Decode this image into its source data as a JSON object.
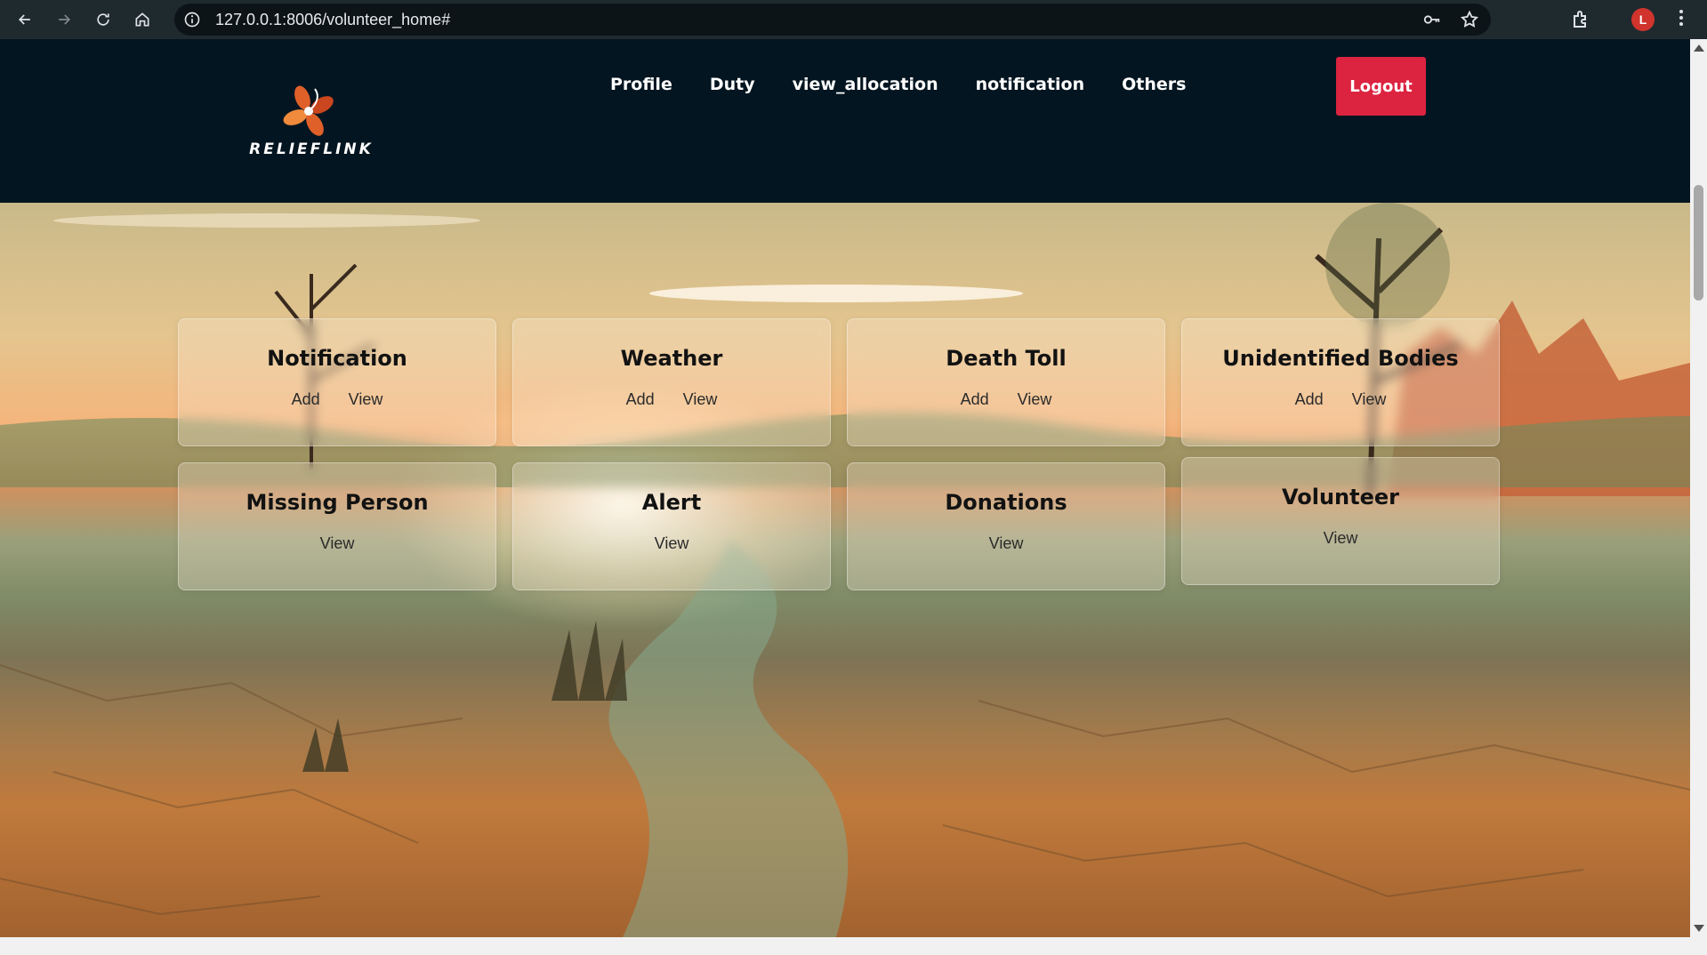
{
  "browser": {
    "url": "127.0.0.1:8006/volunteer_home#",
    "profile_initial": "L"
  },
  "header": {
    "logo_text": "RELIEFLINK",
    "nav": [
      "Profile",
      "Duty",
      "view_allocation",
      "notification",
      "Others"
    ],
    "logout_label": "Logout"
  },
  "cards": [
    {
      "title": "Notification",
      "links": [
        "Add",
        "View"
      ]
    },
    {
      "title": "Weather",
      "links": [
        "Add",
        "View"
      ]
    },
    {
      "title": "Death Toll",
      "links": [
        "Add",
        "View"
      ]
    },
    {
      "title": "Unidentified Bodies",
      "links": [
        "Add",
        "View"
      ]
    },
    {
      "title": "Missing Person",
      "links": [
        "View"
      ]
    },
    {
      "title": "Alert",
      "links": [
        "View"
      ]
    },
    {
      "title": "Donations",
      "links": [
        "View"
      ]
    },
    {
      "title": "Volunteer",
      "links": [
        "View"
      ]
    }
  ],
  "colors": {
    "header_bg": "#031520",
    "logout_bg": "#dc2340",
    "logo_orange": "#e0602a"
  }
}
